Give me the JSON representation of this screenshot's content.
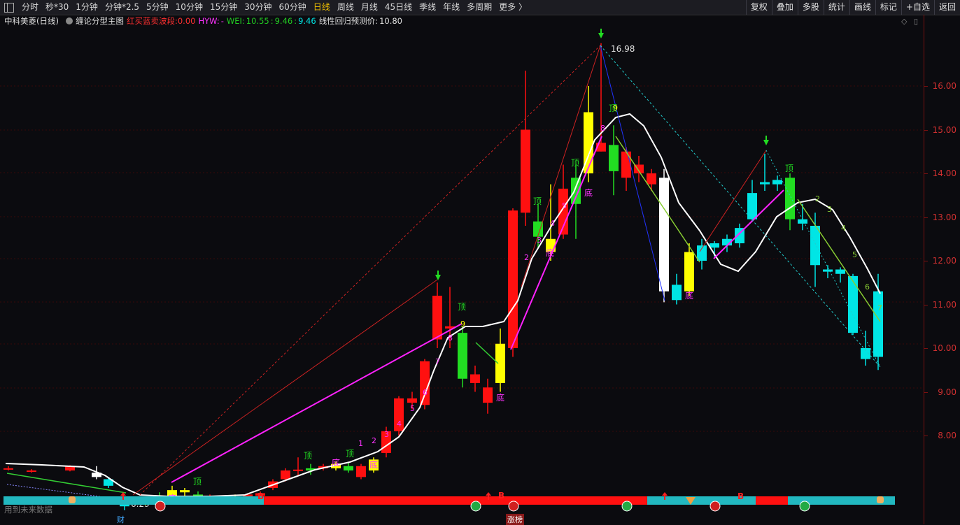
{
  "periods": [
    "分时",
    "秒*30",
    "1分钟",
    "分钟*2.5",
    "5分钟",
    "10分钟",
    "15分钟",
    "30分钟",
    "60分钟",
    "日线",
    "周线",
    "月线",
    "45日线",
    "季线",
    "年线",
    "多周期",
    "更多 〉"
  ],
  "active_period": "日线",
  "tools": [
    "复权",
    "叠加",
    "多股",
    "统计",
    "画线",
    "标记",
    "+自选",
    "返回"
  ],
  "info": {
    "stock": "中科美菱(日线)",
    "indicator": "缠论分型主图",
    "wave_label": "红买蓝卖波段:",
    "wave_value": "0.00",
    "hyw_label": "HYW:",
    "hyw_value": "-",
    "wei_label": "WEI:",
    "wei_value": "10.55",
    "wei_sep": ":",
    "wei_value2": "9.46",
    "wei_sep2": ":",
    "wei_value3": "9.46",
    "predict_label": "线性回归预测价:",
    "predict_value": "10.80"
  },
  "axis_labels": [
    "16.00",
    "15.00",
    "14.00",
    "13.00",
    "12.00",
    "11.00",
    "10.00",
    "9.00",
    "8.00"
  ],
  "high_label": "16.98",
  "low_label": "6.29",
  "future_text": "用到未来数据",
  "bottom": {
    "cai": "财",
    "zhangbang": "涨榜"
  },
  "colors": {
    "up": "#ff1010",
    "down": "#00e5e5",
    "yellow": "#ffff00",
    "green": "#22dd22",
    "white": "#ffffff",
    "magenta": "#ff22ff"
  },
  "marker_texts": {
    "ding": "顶",
    "di": "底",
    "B": "B"
  }
}
